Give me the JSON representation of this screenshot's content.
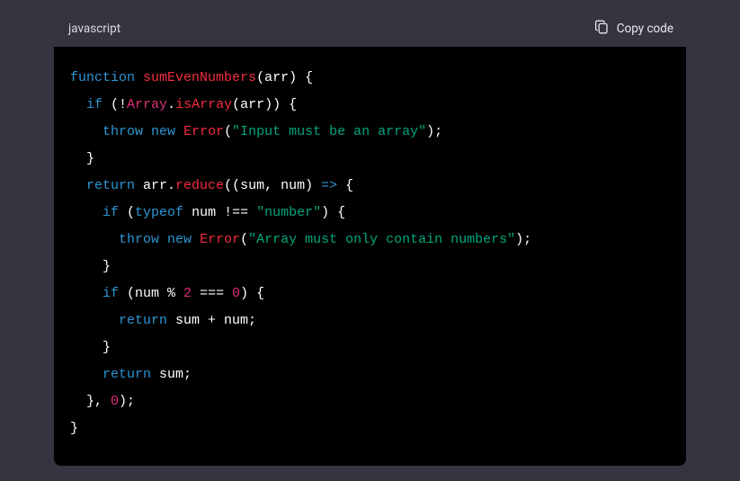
{
  "header": {
    "language": "javascript",
    "copy_label": "Copy code"
  },
  "code": {
    "tokens": [
      [
        [
          "kw",
          "function"
        ],
        [
          "pun",
          " "
        ],
        [
          "fn",
          "sumEvenNumbers"
        ],
        [
          "pun",
          "("
        ],
        [
          "param",
          "arr"
        ],
        [
          "pun",
          ") {"
        ]
      ],
      [
        [
          "pun",
          "  "
        ],
        [
          "kw",
          "if"
        ],
        [
          "pun",
          " (!"
        ],
        [
          "var",
          "Array"
        ],
        [
          "pun",
          "."
        ],
        [
          "fn",
          "isArray"
        ],
        [
          "pun",
          "(arr)) {"
        ]
      ],
      [
        [
          "pun",
          "    "
        ],
        [
          "kw",
          "throw"
        ],
        [
          "pun",
          " "
        ],
        [
          "kw",
          "new"
        ],
        [
          "pun",
          " "
        ],
        [
          "fn",
          "Error"
        ],
        [
          "pun",
          "("
        ],
        [
          "str",
          "\"Input must be an array\""
        ],
        [
          "pun",
          ");"
        ]
      ],
      [
        [
          "pun",
          "  }"
        ]
      ],
      [
        [
          "pun",
          "  "
        ],
        [
          "kw",
          "return"
        ],
        [
          "pun",
          " arr."
        ],
        [
          "fn",
          "reduce"
        ],
        [
          "pun",
          "((sum, num) "
        ],
        [
          "kw",
          "=>"
        ],
        [
          "pun",
          " {"
        ]
      ],
      [
        [
          "pun",
          "    "
        ],
        [
          "kw",
          "if"
        ],
        [
          "pun",
          " ("
        ],
        [
          "kw",
          "typeof"
        ],
        [
          "pun",
          " num !== "
        ],
        [
          "str",
          "\"number\""
        ],
        [
          "pun",
          ") {"
        ]
      ],
      [
        [
          "pun",
          "      "
        ],
        [
          "kw",
          "throw"
        ],
        [
          "pun",
          " "
        ],
        [
          "kw",
          "new"
        ],
        [
          "pun",
          " "
        ],
        [
          "fn",
          "Error"
        ],
        [
          "pun",
          "("
        ],
        [
          "str",
          "\"Array must only contain numbers\""
        ],
        [
          "pun",
          ");"
        ]
      ],
      [
        [
          "pun",
          "    }"
        ]
      ],
      [
        [
          "pun",
          "    "
        ],
        [
          "kw",
          "if"
        ],
        [
          "pun",
          " (num % "
        ],
        [
          "num",
          "2"
        ],
        [
          "pun",
          " === "
        ],
        [
          "num",
          "0"
        ],
        [
          "pun",
          ") {"
        ]
      ],
      [
        [
          "pun",
          "      "
        ],
        [
          "kw",
          "return"
        ],
        [
          "pun",
          " sum + num;"
        ]
      ],
      [
        [
          "pun",
          "    }"
        ]
      ],
      [
        [
          "pun",
          "    "
        ],
        [
          "kw",
          "return"
        ],
        [
          "pun",
          " sum;"
        ]
      ],
      [
        [
          "pun",
          "  }, "
        ],
        [
          "num",
          "0"
        ],
        [
          "pun",
          ");"
        ]
      ],
      [
        [
          "pun",
          "}"
        ]
      ]
    ]
  }
}
